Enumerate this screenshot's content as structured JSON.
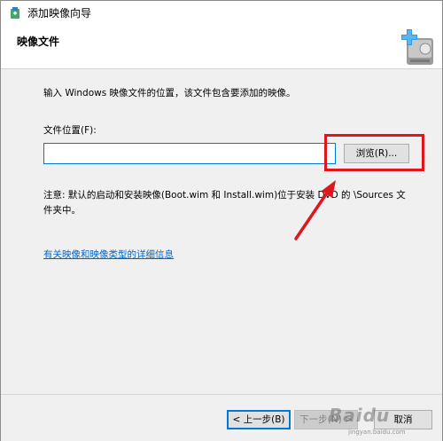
{
  "window": {
    "title": "添加映像向导"
  },
  "header": {
    "title": "映像文件",
    "icon": "add-image-wizard-icon"
  },
  "content": {
    "description": "输入 Windows 映像文件的位置，该文件包含要添加的映像。",
    "location_label": "文件位置(F):",
    "location_value": "",
    "browse_label": "浏览(R)...",
    "note": "注意: 默认的启动和安装映像(Boot.wim 和 Install.wim)位于安装 DVD 的 \\Sources 文件夹中。",
    "more_info_link": "有关映像和映像类型的详细信息"
  },
  "footer": {
    "back_label": "< 上一步(B)",
    "next_label": "下一步(N) >",
    "cancel_label": "取消"
  },
  "annotation": {
    "highlight_color": "#e0161c",
    "accent_color": "#0078d7"
  },
  "watermark": {
    "text": "Baidu",
    "subtext": "jingyan.baidu.com"
  }
}
